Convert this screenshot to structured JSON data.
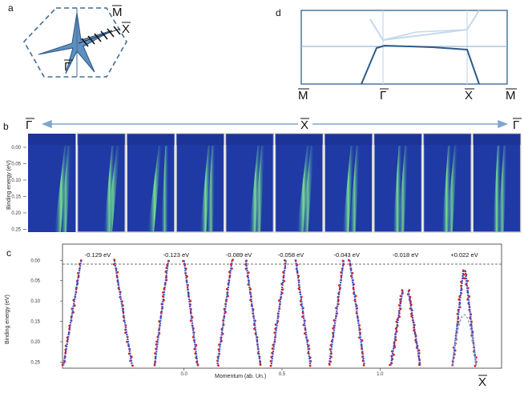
{
  "panels": {
    "a": {
      "letter": "a",
      "labels": {
        "M": "M",
        "X": "X",
        "G": "Γ"
      }
    },
    "d": {
      "letter": "d",
      "axis_labels": [
        "M",
        "Γ",
        "X",
        "M"
      ]
    },
    "b": {
      "letter": "b",
      "left_label": "Γ",
      "mid_label": "X",
      "right_label": "Γ",
      "ylabel": "Binding energy (eV)",
      "yticks": [
        "0.00",
        "0.05",
        "0.10",
        "0.15",
        "0.20",
        "0.25"
      ],
      "n_frames": 10
    },
    "c": {
      "letter": "c",
      "ylabel": "Binding energy (eV)",
      "xlabel": "Momentum (ab. Un.)",
      "yticks": [
        "0.00",
        "0.05",
        "0.10",
        "0.15",
        "0.20",
        "0.25"
      ],
      "xticks": [
        "0.0",
        "0.5",
        "1.0"
      ],
      "x_end_label": "X"
    }
  },
  "chart_data": {
    "type": "scatter",
    "title": "",
    "xlabel": "Momentum (ab. Un.)",
    "ylabel": "Binding energy (eV)",
    "xlim": [
      -0.62,
      1.62
    ],
    "ylim": [
      0.265,
      -0.04
    ],
    "series": [
      {
        "label": "-0.129 eV",
        "apex_energy": -0.129,
        "center": -0.44,
        "half_width_at_top": 0.085,
        "half_width_at_bottom": 0.175,
        "top_energy": 0.0
      },
      {
        "label": "-0.123 eV",
        "apex_energy": -0.123,
        "center": -0.04,
        "half_width_at_top": 0.04,
        "half_width_at_bottom": 0.11,
        "top_energy": 0.0
      },
      {
        "label": "-0.089 eV",
        "apex_energy": -0.089,
        "center": 0.28,
        "half_width_at_top": 0.035,
        "half_width_at_bottom": 0.11,
        "top_energy": 0.0
      },
      {
        "label": "-0.058 eV",
        "apex_energy": -0.058,
        "center": 0.545,
        "half_width_at_top": 0.025,
        "half_width_at_bottom": 0.1,
        "top_energy": 0.0
      },
      {
        "label": "-0.043 eV",
        "apex_energy": -0.043,
        "center": 0.83,
        "half_width_at_top": 0.015,
        "half_width_at_bottom": 0.09,
        "top_energy": 0.0
      },
      {
        "label": "-0.018 eV",
        "apex_energy": -0.018,
        "center": 1.13,
        "half_width_at_top": 0.015,
        "half_width_at_bottom": 0.075,
        "top_energy": 0.075
      },
      {
        "label": "+0.022 eV",
        "apex_energy": 0.022,
        "center": 1.43,
        "half_width_at_top": 0.005,
        "half_width_at_bottom": 0.06,
        "top_energy": 0.025
      }
    ]
  },
  "colors": {
    "bz": "#3f6c9a",
    "bz_light": "#c5d8ec",
    "arrow": "#7ea6d0",
    "points": "#e81c1c",
    "fit": "#3a4fbf",
    "fit_dashed": "#7aa6d6",
    "arpes_bg": "#1f3aa5",
    "arpes_band": "#55c99a"
  }
}
